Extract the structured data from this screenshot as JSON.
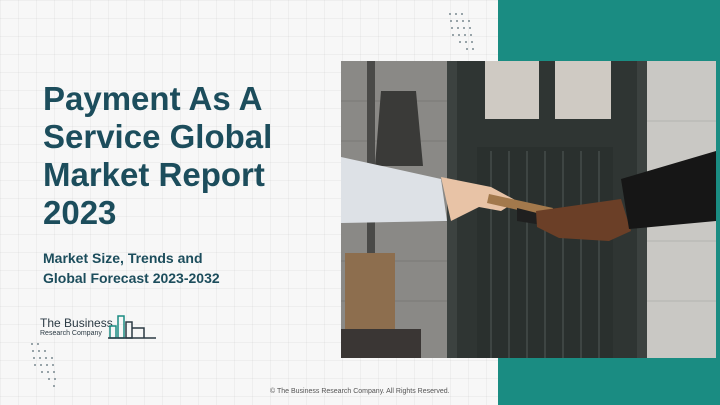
{
  "slide": {
    "title_lines": [
      "Payment As A",
      "Service Global",
      "Market Report",
      "2023"
    ],
    "subtitle_lines": [
      "Market Size, Trends and",
      "Global Forecast 2023-2032"
    ],
    "logo": {
      "line1": "The Business",
      "line2": "Research Company"
    },
    "footer": "© The Business Research Company. All Rights Reserved."
  },
  "colors": {
    "accent_teal": "#1a8c82",
    "title": "#1c4d5c",
    "background": "#f7f7f7"
  }
}
